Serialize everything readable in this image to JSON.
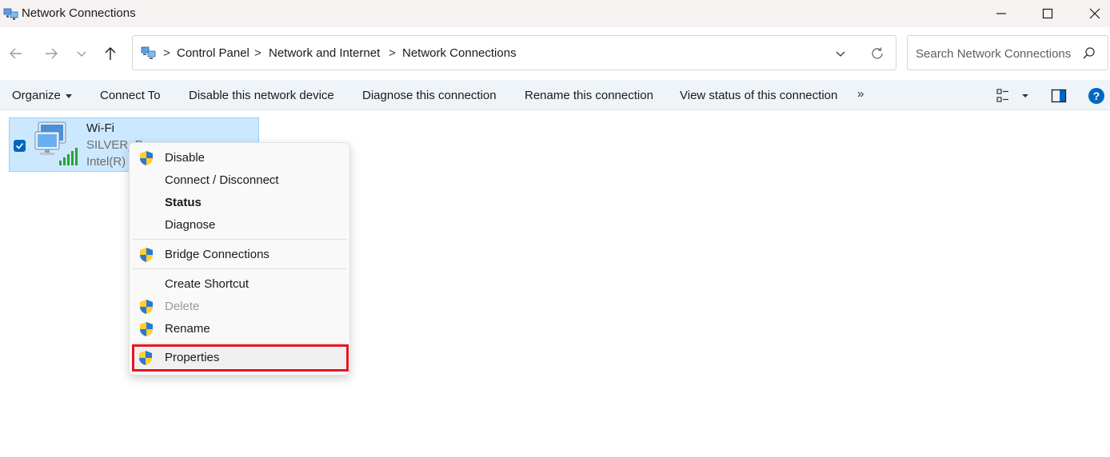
{
  "window": {
    "title": "Network Connections",
    "icons": {
      "app": "network-connections-icon",
      "minimize": "minimize-icon",
      "maximize": "maximize-icon",
      "close": "close-icon"
    }
  },
  "address_bar": {
    "breadcrumbs": [
      "Control Panel",
      "Network and Internet",
      "Network Connections"
    ],
    "separator": ">",
    "icons": {
      "back": "back-arrow-icon",
      "forward": "forward-arrow-icon",
      "recent": "chevron-down-icon",
      "up": "up-arrow-icon",
      "dropdown": "chevron-down-icon",
      "refresh": "refresh-icon"
    }
  },
  "search": {
    "placeholder": "Search Network Connections",
    "value": ""
  },
  "command_bar": {
    "organize": "Organize",
    "connect_to": "Connect To",
    "disable_device": "Disable this network device",
    "diagnose": "Diagnose this connection",
    "rename": "Rename this connection",
    "view_status": "View status of this connection",
    "more": "»",
    "icons": {
      "view": "change-view-icon",
      "preview_pane": "preview-pane-icon",
      "help": "help-icon"
    }
  },
  "connection": {
    "name": "Wi-Fi",
    "ssid": "SILVER_P",
    "adapter": "Intel(R)",
    "selected": true
  },
  "context_menu": {
    "items": [
      {
        "label": "Disable",
        "shield": true
      },
      {
        "label": "Connect / Disconnect",
        "shield": false
      },
      {
        "label": "Status",
        "shield": false,
        "bold": true
      },
      {
        "label": "Diagnose",
        "shield": false
      },
      {
        "label": "Bridge Connections",
        "shield": true
      },
      {
        "label": "Create Shortcut",
        "shield": false
      },
      {
        "label": "Delete",
        "shield": true,
        "disabled": true
      },
      {
        "label": "Rename",
        "shield": true
      },
      {
        "label": "Properties",
        "shield": true,
        "highlighted": true
      }
    ]
  },
  "colors": {
    "accent": "#0067c0",
    "selection_bg": "#cce8ff",
    "highlight_border": "#e3161e",
    "command_bar_bg": "#eff4f9"
  }
}
